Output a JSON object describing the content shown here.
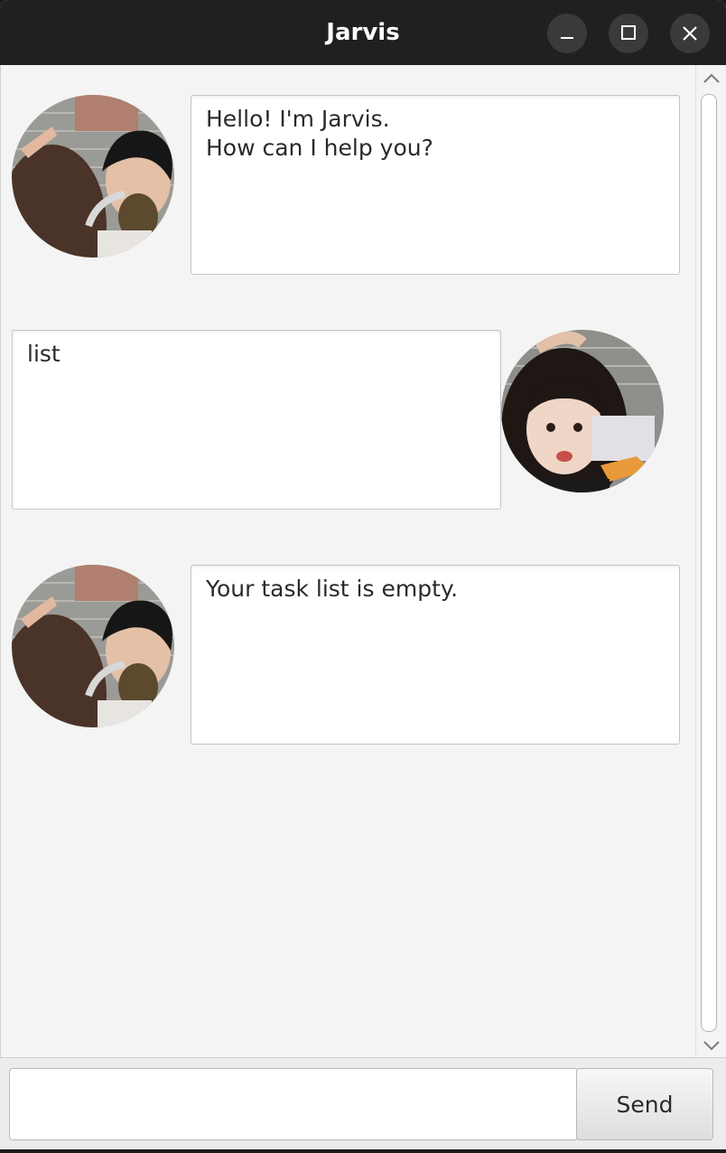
{
  "window": {
    "title": "Jarvis"
  },
  "title_controls": {
    "minimize_icon": "minimize-icon",
    "maximize_icon": "maximize-icon",
    "close_icon": "close-icon"
  },
  "messages": [
    {
      "sender": "bot",
      "text": "Hello! I'm Jarvis.\nHow can I help you?"
    },
    {
      "sender": "user",
      "text": "list"
    },
    {
      "sender": "bot",
      "text": "Your task list is empty."
    }
  ],
  "input": {
    "value": "",
    "placeholder": ""
  },
  "send_button": {
    "label": "Send"
  },
  "colors": {
    "titlebar": "#202020",
    "background": "#f4f4f4",
    "bubble": "#ffffff",
    "text": "#2a2a2a"
  }
}
